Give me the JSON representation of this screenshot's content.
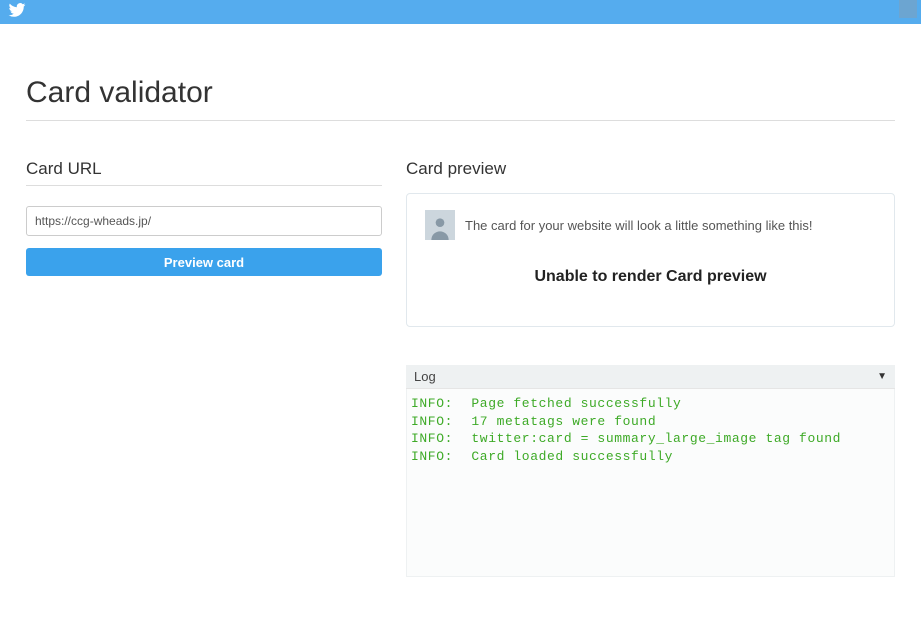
{
  "page": {
    "title": "Card validator"
  },
  "left": {
    "section_label": "Card URL",
    "url_value": "https://ccg-wheads.jp/",
    "button_label": "Preview card"
  },
  "right": {
    "section_label": "Card preview",
    "preview_hint": "The card for your website will look a little something like this!",
    "error_text": "Unable to render Card preview"
  },
  "log": {
    "label": "Log",
    "entries": [
      {
        "level": "INFO:",
        "msg": "Page fetched successfully"
      },
      {
        "level": "INFO:",
        "msg": "17 metatags were found"
      },
      {
        "level": "INFO:",
        "msg": "twitter:card = summary_large_image tag found"
      },
      {
        "level": "INFO:",
        "msg": "Card loaded successfully"
      }
    ]
  }
}
